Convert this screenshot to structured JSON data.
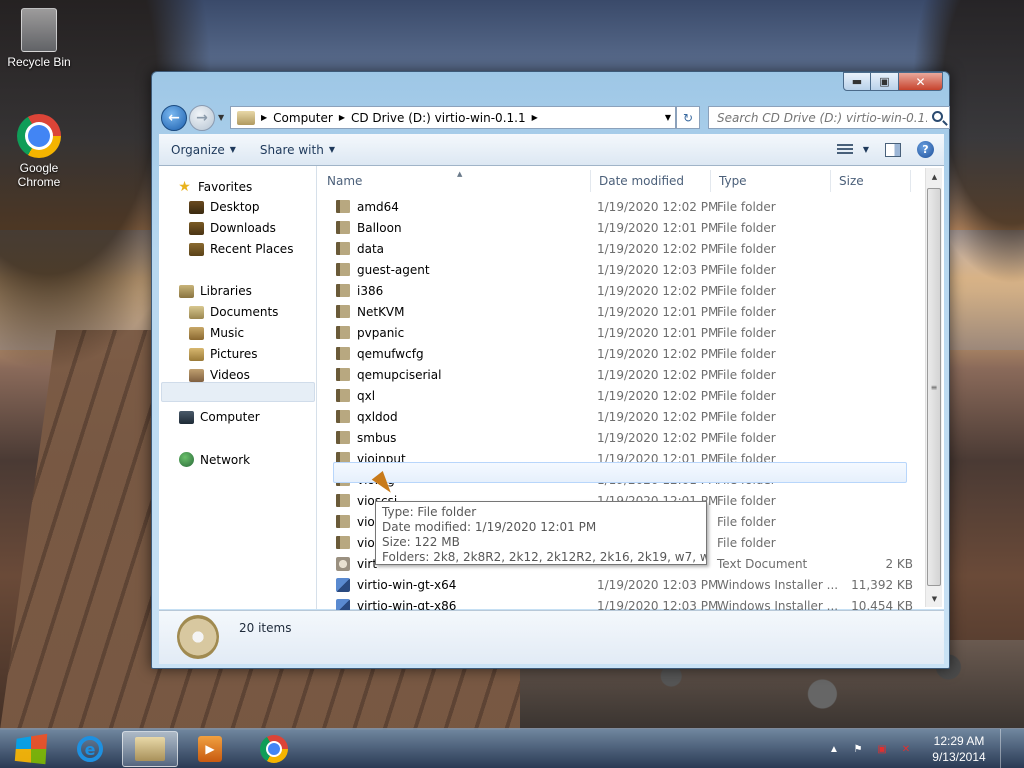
{
  "desktop": {
    "icons": [
      {
        "label": "Recycle Bin"
      },
      {
        "label": "Google Chrome"
      }
    ]
  },
  "window": {
    "controls": {
      "minimize": "▬",
      "maximize": "▣",
      "close": "✕"
    },
    "nav": {
      "back": "←",
      "forward": "→",
      "recent_caret": "▼"
    },
    "address": {
      "crumbs": [
        "Computer",
        "CD Drive (D:) virtio-win-0.1.1"
      ],
      "separator": "▶",
      "dropdown": "▼",
      "refresh": "↻"
    },
    "search": {
      "placeholder": "Search CD Drive (D:) virtio-win-0.1.1"
    },
    "toolbar": {
      "organize": "Organize",
      "share_with": "Share with",
      "caret": "▼",
      "help": "?"
    },
    "nav_pane": {
      "favorites": "Favorites",
      "favorites_items": [
        "Desktop",
        "Downloads",
        "Recent Places"
      ],
      "libraries": "Libraries",
      "libraries_items": [
        "Documents",
        "Music",
        "Pictures",
        "Videos"
      ],
      "computer": "Computer",
      "network": "Network"
    },
    "columns": {
      "name": "Name",
      "date": "Date modified",
      "type": "Type",
      "size": "Size",
      "sort_arrow": "▲"
    },
    "rows": [
      {
        "name": "amd64",
        "date": "1/19/2020 12:02 PM",
        "type": "File folder",
        "size": ""
      },
      {
        "name": "Balloon",
        "date": "1/19/2020 12:01 PM",
        "type": "File folder",
        "size": ""
      },
      {
        "name": "data",
        "date": "1/19/2020 12:02 PM",
        "type": "File folder",
        "size": ""
      },
      {
        "name": "guest-agent",
        "date": "1/19/2020 12:03 PM",
        "type": "File folder",
        "size": ""
      },
      {
        "name": "i386",
        "date": "1/19/2020 12:02 PM",
        "type": "File folder",
        "size": ""
      },
      {
        "name": "NetKVM",
        "date": "1/19/2020 12:01 PM",
        "type": "File folder",
        "size": ""
      },
      {
        "name": "pvpanic",
        "date": "1/19/2020 12:01 PM",
        "type": "File folder",
        "size": ""
      },
      {
        "name": "qemufwcfg",
        "date": "1/19/2020 12:02 PM",
        "type": "File folder",
        "size": ""
      },
      {
        "name": "qemupciserial",
        "date": "1/19/2020 12:02 PM",
        "type": "File folder",
        "size": ""
      },
      {
        "name": "qxl",
        "date": "1/19/2020 12:02 PM",
        "type": "File folder",
        "size": ""
      },
      {
        "name": "qxldod",
        "date": "1/19/2020 12:02 PM",
        "type": "File folder",
        "size": ""
      },
      {
        "name": "smbus",
        "date": "1/19/2020 12:02 PM",
        "type": "File folder",
        "size": ""
      },
      {
        "name": "vioinput",
        "date": "1/19/2020 12:01 PM",
        "type": "File folder",
        "size": ""
      },
      {
        "name": "viorng",
        "date": "1/19/2020 12:01 PM",
        "type": "File folder",
        "size": ""
      },
      {
        "name": "vioscsi",
        "date": "1/19/2020 12:01 PM",
        "type": "File folder",
        "size": ""
      },
      {
        "name": "vios",
        "date": "",
        "type": "File folder",
        "size": ""
      },
      {
        "name": "vios",
        "date": "",
        "type": "File folder",
        "size": ""
      },
      {
        "name": "virt",
        "date": "",
        "type": "Text Document",
        "size": "2 KB"
      },
      {
        "name": "virtio-win-gt-x64",
        "date": "1/19/2020 12:03 PM",
        "type": "Windows Installer ...",
        "size": "11,392 KB"
      },
      {
        "name": "virtio-win-gt-x86",
        "date": "1/19/2020 12:03 PM",
        "type": "Windows Installer ...",
        "size": "10,454 KB"
      }
    ],
    "row_icons": [
      "folder",
      "folder",
      "folder",
      "folder",
      "folder",
      "folder",
      "folder",
      "folder",
      "folder",
      "folder",
      "folder",
      "folder",
      "folder",
      "folder",
      "folder",
      "folder",
      "folder",
      "txt",
      "msi",
      "msi"
    ],
    "tooltip": {
      "type": "Type: File folder",
      "date": "Date modified: 1/19/2020 12:01 PM",
      "size": "Size: 122 MB",
      "folders": "Folders: 2k8, 2k8R2, 2k12, 2k12R2, 2k16, 2k19, w7, w8, w8.1, ..."
    },
    "scroll": {
      "up": "▲",
      "down": "▼",
      "grip": "≡"
    },
    "details": {
      "item_count": "20 items"
    }
  },
  "taskbar": {
    "apps": [
      {
        "name": "internet-explorer",
        "glyph": "e"
      },
      {
        "name": "windows-explorer",
        "glyph": ""
      },
      {
        "name": "media-player",
        "glyph": "▶"
      },
      {
        "name": "google-chrome",
        "glyph": ""
      }
    ],
    "tray": {
      "expand": "▲",
      "flag": "⚑",
      "network": "▣",
      "volume": "✕"
    },
    "clock": {
      "time": "12:29 AM",
      "date": "9/13/2014"
    }
  }
}
